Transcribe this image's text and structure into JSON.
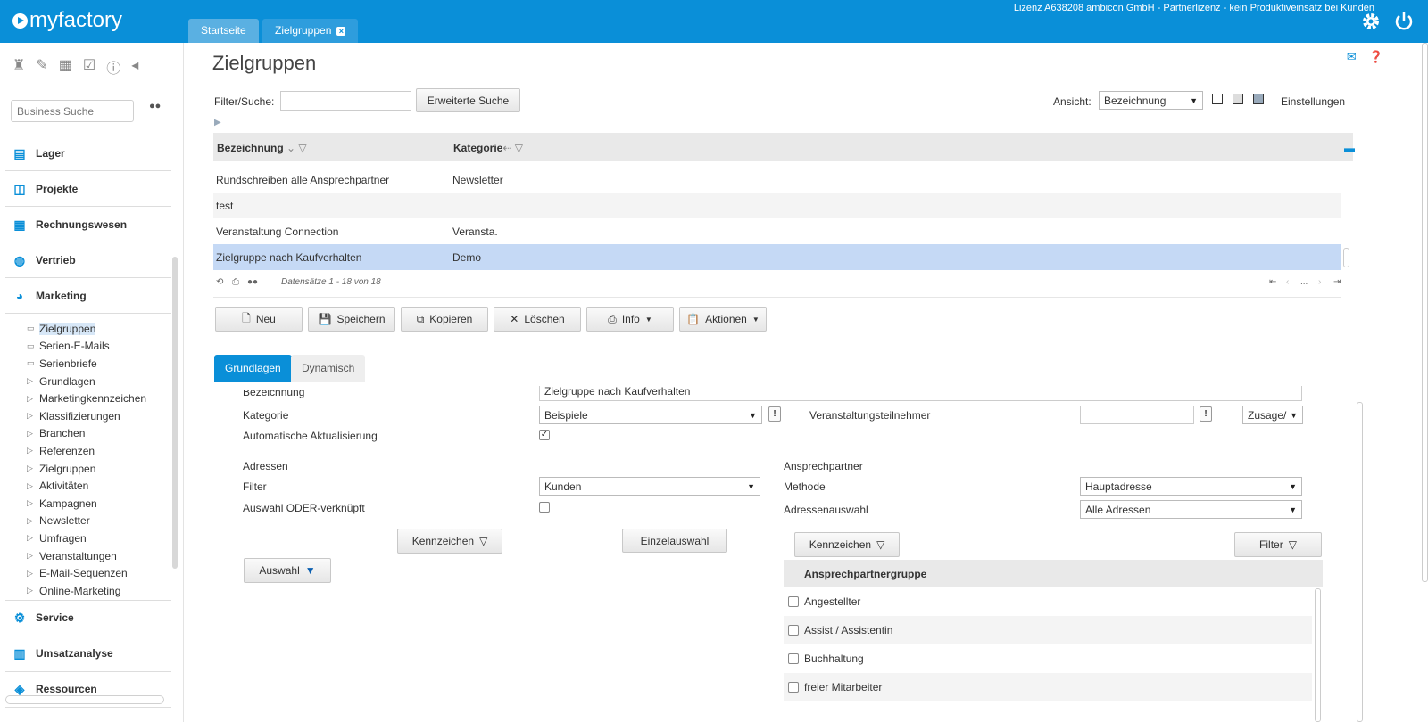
{
  "app": {
    "logo": "myfactory",
    "license": "Lizenz A638208 ambicon GmbH - Partnerlizenz - kein Produktiveinsatz bei Kunden"
  },
  "tabs": [
    {
      "label": "Startseite"
    },
    {
      "label": "Zielgruppen",
      "close": "×"
    }
  ],
  "sidebar": {
    "search_placeholder": "Business Suche",
    "nav": [
      {
        "label": "Lager",
        "icon": "warehouse-icon"
      },
      {
        "label": "Projekte",
        "icon": "projects-icon"
      },
      {
        "label": "Rechnungswesen",
        "icon": "accounting-icon"
      },
      {
        "label": "Vertrieb",
        "icon": "sales-icon"
      },
      {
        "label": "Marketing",
        "icon": "marketing-icon"
      }
    ],
    "marketing_items": [
      "Zielgruppen",
      "Serien-E-Mails",
      "Serienbriefe",
      "Grundlagen",
      "Marketingkennzeichen",
      "Klassifizierungen",
      "Branchen",
      "Referenzen",
      "Zielgruppen",
      "Aktivitäten",
      "Kampagnen",
      "Newsletter",
      "Umfragen",
      "Veranstaltungen",
      "E-Mail-Sequenzen",
      "Online-Marketing"
    ],
    "nav_bottom": [
      {
        "label": "Service",
        "icon": "service-icon"
      },
      {
        "label": "Umsatzanalyse",
        "icon": "chart-icon"
      },
      {
        "label": "Ressourcen",
        "icon": "resources-icon"
      }
    ]
  },
  "page": {
    "title": "Zielgruppen",
    "filter_label": "Filter/Suche:",
    "extended_search": "Erweiterte Suche",
    "view_label": "Ansicht:",
    "view_value": "Bezeichnung",
    "settings": "Einstellungen"
  },
  "grid": {
    "col1": "Bezeichnung",
    "col2": "Kategorie",
    "rows": [
      {
        "name": "Rundschreiben alle Ansprechpartner",
        "category": "Newsletter"
      },
      {
        "name": "test",
        "category": ""
      },
      {
        "name": "Veranstaltung Connection",
        "category": "Veransta."
      },
      {
        "name": "Zielgruppe nach Kaufverhalten",
        "category": "Demo"
      }
    ],
    "records": "Datensätze 1 - 18 von 18",
    "pager_dots": "..."
  },
  "toolbar": {
    "neu": "Neu",
    "speichern": "Speichern",
    "kopieren": "Kopieren",
    "loeschen": "Löschen",
    "info": "Info",
    "aktionen": "Aktionen"
  },
  "form": {
    "tab_grundlagen": "Grundlagen",
    "tab_dynamisch": "Dynamisch",
    "bezeichnung_label": "Bezeichnung",
    "bezeichnung_value": "Zielgruppe nach Kaufverhalten",
    "kategorie_label": "Kategorie",
    "kategorie_value": "Beispiele",
    "teilnehmer_label": "Veranstaltungsteilnehmer",
    "zusage_value": "Zusage/",
    "auto_label": "Automatische Aktualisierung",
    "adressen_label": "Adressen",
    "filter_label": "Filter",
    "filter_value": "Kunden",
    "oder_label": "Auswahl ODER-verknüpft",
    "ansprechpartner_label": "Ansprechpartner",
    "methode_label": "Methode",
    "methode_value": "Hauptadresse",
    "adressauswahl_label": "Adressenauswahl",
    "adressauswahl_value": "Alle Adressen",
    "kennzeichen_btn": "Kennzeichen",
    "einzelauswahl_btn": "Einzelauswahl",
    "auswahl_btn": "Auswahl",
    "kennzeichen_btn2": "Kennzeichen",
    "filter_btn": "Filter",
    "apg_header": "Ansprechpartnergruppe",
    "apg_rows": [
      "Angestellter",
      "Assist / Assistentin",
      "Buchhaltung",
      "freier Mitarbeiter"
    ]
  },
  "colors": {
    "brand": "#0a8fd8",
    "selected_row": "#c5d9f5"
  }
}
